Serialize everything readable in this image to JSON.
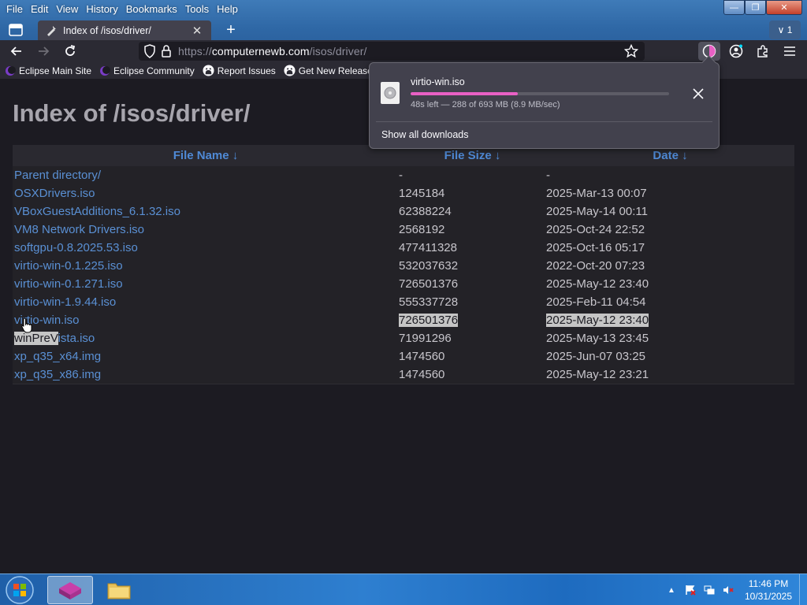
{
  "menu": [
    "File",
    "Edit",
    "View",
    "History",
    "Bookmarks",
    "Tools",
    "Help"
  ],
  "window_controls": {
    "minimize": "—",
    "maximize": "❐",
    "close": "✕"
  },
  "tab": {
    "title": "Index of /isos/driver/",
    "close_glyph": "✕",
    "new_tab_glyph": "+",
    "tab_count": "∨ 1"
  },
  "url": {
    "scheme": "https://",
    "host": "computernewb.com",
    "path": "/isos/driver/"
  },
  "bookmarks": [
    {
      "label": "Eclipse Main Site",
      "icon": "eclipse-icon"
    },
    {
      "label": "Eclipse Community",
      "icon": "eclipse-icon"
    },
    {
      "label": "Report Issues",
      "icon": "github-icon"
    },
    {
      "label": "Get New Releases",
      "icon": "github-icon"
    }
  ],
  "page": {
    "title": "Index of /isos/driver/",
    "headers": {
      "name": "File Name  ↓",
      "size": "File Size  ↓",
      "date": "Date  ↓"
    },
    "rows": [
      {
        "name": "Parent directory/",
        "size": "-",
        "date": "-"
      },
      {
        "name": "OSXDrivers.iso",
        "size": "1245184",
        "date": "2025-Mar-13 00:07"
      },
      {
        "name": "VBoxGuestAdditions_6.1.32.iso",
        "size": "62388224",
        "date": "2025-May-14 00:11"
      },
      {
        "name": "VM8 Network Drivers.iso",
        "size": "2568192",
        "date": "2025-Oct-24 22:52"
      },
      {
        "name": "softgpu-0.8.2025.53.iso",
        "size": "477411328",
        "date": "2025-Oct-16 05:17"
      },
      {
        "name": "virtio-win-0.1.225.iso",
        "size": "532037632",
        "date": "2022-Oct-20 07:23"
      },
      {
        "name": "virtio-win-0.1.271.iso",
        "size": "726501376",
        "date": "2025-May-12 23:40"
      },
      {
        "name": "virtio-win-1.9.44.iso",
        "size": "555337728",
        "date": "2025-Feb-11 04:54"
      },
      {
        "name": "virtio-win.iso",
        "size": "726501376",
        "date": "2025-May-12 23:40"
      },
      {
        "name": "winPreVista.iso",
        "size": "71991296",
        "date": "2025-May-13 23:45"
      },
      {
        "name": "xp_q35_x64.img",
        "size": "1474560",
        "date": "2025-Jun-07 03:25"
      },
      {
        "name": "xp_q35_x86.img",
        "size": "1474560",
        "date": "2025-May-12 23:21"
      }
    ],
    "selected_row_index": 8,
    "selected_name_prefix_next_row": "winPreV"
  },
  "download": {
    "filename": "virtio-win.iso",
    "status": "48s left — 288 of 693 MB (8.9 MB/sec)",
    "progress_fraction": 0.4156,
    "show_all": "Show all downloads"
  },
  "taskbar": {
    "clock_time": "11:46 PM",
    "clock_date": "10/31/2025"
  },
  "colors": {
    "link": "#5a90d4",
    "header_link": "#4f8ad6",
    "progress": "#e860c4",
    "page_bg": "#1c1b22"
  }
}
